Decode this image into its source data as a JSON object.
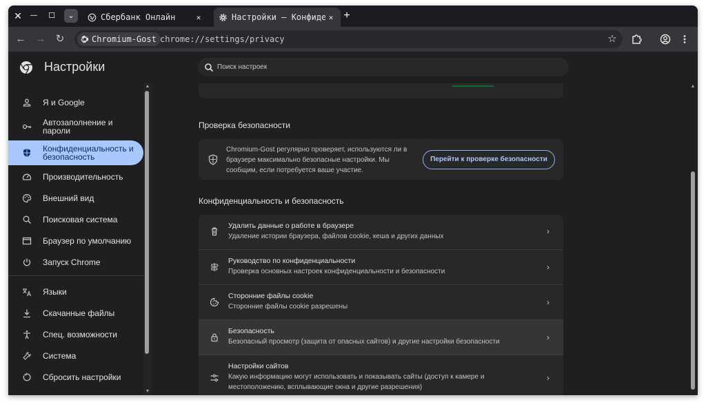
{
  "window_controls": {
    "close": "✕",
    "minimize": "—",
    "maximize": "☐",
    "tab_search": "⌄"
  },
  "tabs": [
    {
      "title": "Сбербанк Онлайн",
      "icon": "globe-icon",
      "close": "✕"
    },
    {
      "title": "Настройки – Конфиденциальность",
      "icon": "gear-icon",
      "close": "✕"
    }
  ],
  "new_tab": "+",
  "toolbar": {
    "back": "←",
    "forward": "→",
    "reload": "↻",
    "site_chip": "Chromium-Gost",
    "url": "chrome://settings/privacy",
    "bookmark": "☆"
  },
  "header": {
    "title": "Настройки",
    "search_placeholder": "Поиск настроек"
  },
  "sidebar": {
    "items": [
      {
        "label": "Я и Google",
        "icon": "person-icon"
      },
      {
        "label": "Автозаполнение и пароли",
        "icon": "key-icon"
      },
      {
        "label": "Конфиденциальность и безопасность",
        "icon": "shield-icon",
        "selected": true
      },
      {
        "label": "Производительность",
        "icon": "speedometer-icon"
      },
      {
        "label": "Внешний вид",
        "icon": "palette-icon"
      },
      {
        "label": "Поисковая система",
        "icon": "search-icon"
      },
      {
        "label": "Браузер по умолчанию",
        "icon": "browser-window-icon"
      },
      {
        "label": "Запуск Chrome",
        "icon": "power-icon"
      },
      {
        "label": "Языки",
        "icon": "translate-icon"
      },
      {
        "label": "Скачанные файлы",
        "icon": "download-icon"
      },
      {
        "label": "Спец. возможности",
        "icon": "accessibility-icon"
      },
      {
        "label": "Система",
        "icon": "wrench-icon"
      },
      {
        "label": "Сбросить настройки",
        "icon": "reset-icon"
      }
    ]
  },
  "safety_check": {
    "title": "Проверка безопасности",
    "description": "Chromium-Gost регулярно проверяет, используются ли в браузере максимально безопасные настройки. Мы сообщим, если потребуется ваше участие.",
    "button": "Перейти к проверке безопасности"
  },
  "privacy": {
    "title": "Конфиденциальность и безопасность",
    "rows": [
      {
        "title": "Удалить данные о работе в браузере",
        "subtitle": "Удаление истории браузера, файлов cookie, кеша и других данных",
        "icon": "trash-icon"
      },
      {
        "title": "Руководство по конфиденциальности",
        "subtitle": "Проверка основных настроек конфиденциальности и безопасности",
        "icon": "privacy-guide-icon"
      },
      {
        "title": "Сторонние файлы cookie",
        "subtitle": "Сторонние файлы cookie разрешены",
        "icon": "cookie-icon"
      },
      {
        "title": "Безопасность",
        "subtitle": "Безопасный просмотр (защита от опасных сайтов) и другие настройки безопасности",
        "icon": "lock-icon"
      },
      {
        "title": "Настройки сайтов",
        "subtitle": "Какую информацию могут использовать и показывать сайты (доступ к камере и местоположению, всплывающие окна и другие разрешения)",
        "icon": "tune-icon"
      }
    ]
  },
  "colors": {
    "background": "#1f1f1f",
    "card": "#282828",
    "selected_nav": "#a8c7fa",
    "accent_border": "#8ab4f8"
  }
}
